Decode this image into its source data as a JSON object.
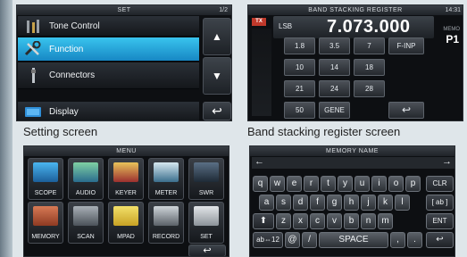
{
  "settings_screen": {
    "title": "SET",
    "page": "1/2",
    "items": [
      {
        "label": "Tone Control",
        "icon": "tone-control-icon"
      },
      {
        "label": "Function",
        "icon": "tools-icon",
        "selected": true
      },
      {
        "label": "Connectors",
        "icon": "connector-icon"
      },
      {
        "label": "Display",
        "icon": "display-icon"
      }
    ],
    "up_icon": "▲",
    "down_icon": "▼",
    "back_icon": "↩",
    "caption": "Setting screen"
  },
  "band_stacking_screen": {
    "title": "BAND STACKING REGISTER",
    "tx_badge": "TX",
    "mode": "LSB",
    "frequency": "7.073.000",
    "time": "14:31",
    "memo_label": "MEMO",
    "memo_value": "P1",
    "buttons": [
      "1.8",
      "3.5",
      "7",
      "F-INP",
      "10",
      "14",
      "18",
      "21",
      "24",
      "28",
      "50",
      "GENE"
    ],
    "back_icon": "↩",
    "caption": "Band stacking register screen"
  },
  "menu_screen": {
    "title": "MENU",
    "items": [
      "SCOPE",
      "AUDIO",
      "KEYER",
      "METER",
      "SWR",
      "MEMORY",
      "SCAN",
      "MPAD",
      "RECORD",
      "SET"
    ],
    "back_icon": "↩"
  },
  "memory_name_screen": {
    "title": "MEMORY NAME",
    "left_arrow": "←",
    "right_arrow": "→",
    "row1": [
      "q",
      "w",
      "e",
      "r",
      "t",
      "y",
      "u",
      "i",
      "o",
      "p"
    ],
    "row2": [
      "a",
      "s",
      "d",
      "f",
      "g",
      "h",
      "j",
      "k",
      "l"
    ],
    "row3": [
      "z",
      "x",
      "c",
      "v",
      "b",
      "n",
      "m"
    ],
    "shift": "⬆",
    "clr": "CLR",
    "ab": "[ ab ]",
    "ent": "ENT",
    "abc12": "ab⇔12",
    "at": "@",
    "slash": "/",
    "space": "SPACE",
    "comma": ",",
    "period": ".",
    "back_icon": "↩"
  },
  "colors": {
    "selected": "#28a8dd",
    "panel": "#0d0f12",
    "tx_red": "#c0392b",
    "background": "#dfe6ea"
  }
}
